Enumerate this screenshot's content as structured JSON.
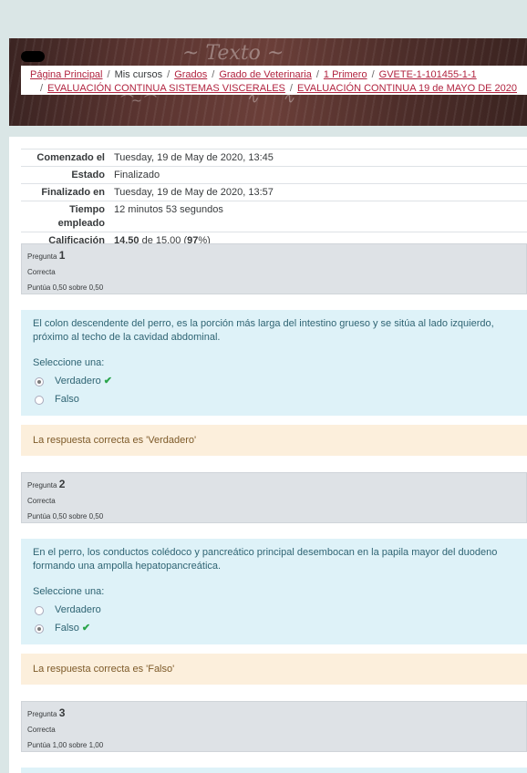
{
  "breadcrumb": {
    "home": "Página Principal",
    "my_courses": "Mis cursos",
    "grados": "Grados",
    "degree": "Grado de Veterinaria",
    "year": "1 Primero",
    "course": "GVETE-1-101455-1-1",
    "section": "EVALUACIÓN CONTINUA SISTEMAS VISCERALES",
    "quiz": "EVALUACIÓN CONTINUA 19 de MAYO DE 2020"
  },
  "summary": {
    "started_label": "Comenzado el",
    "started_value": "Tuesday, 19 de May de 2020, 13:45",
    "state_label": "Estado",
    "state_value": "Finalizado",
    "finished_label": "Finalizado en",
    "finished_value": "Tuesday, 19 de May de 2020, 13:57",
    "time_label_1": "Tiempo",
    "time_label_2": "empleado",
    "time_value": "12 minutos 53 segundos",
    "grade_label": "Calificación",
    "grade_score": "14,50",
    "grade_mid": " de 15,00 (",
    "grade_pct": "97",
    "grade_end": "%)"
  },
  "questions": [
    {
      "pregunta": "Pregunta",
      "number": "1",
      "status": "Correcta",
      "points": "Puntúa 0,50 sobre 0,50",
      "text": "El colon descendente del perro, es la porción más larga del intestino grueso y se sitúa al lado izquierdo, próximo al techo de la cavidad abdominal.",
      "prompt": "Seleccione una:",
      "options": [
        "Verdadero",
        "Falso"
      ],
      "feedback": "La respuesta correcta es 'Verdadero'"
    },
    {
      "pregunta": "Pregunta",
      "number": "2",
      "status": "Correcta",
      "points": "Puntúa 0,50 sobre 0,50",
      "text": "En el perro, los conductos colédoco y pancreático principal desembocan en la papila mayor del duodeno formando una ampolla hepatopancreática.",
      "prompt": "Seleccione una:",
      "options": [
        "Verdadero",
        "Falso"
      ],
      "feedback": "La respuesta correcta es 'Falso'"
    },
    {
      "pregunta": "Pregunta",
      "number": "3",
      "status": "Correcta",
      "points": "Puntúa 1,00 sobre 1,00"
    }
  ],
  "colors": {
    "page_bg": "#dae6e6",
    "link": "#b1233f",
    "question_bg": "#def2f8",
    "feedback_bg": "#fcefdc",
    "correct_tick": "#2aa54b"
  }
}
